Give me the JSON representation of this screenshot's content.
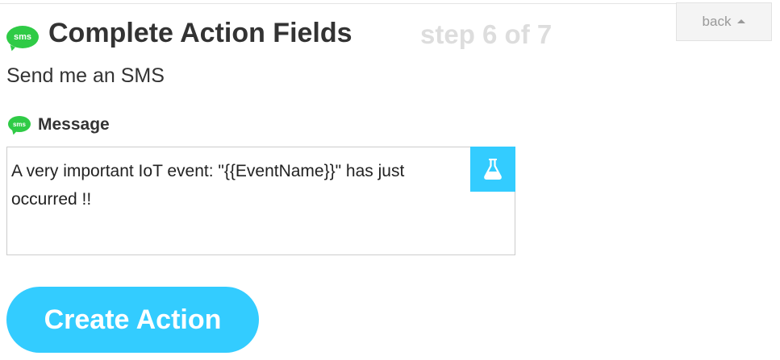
{
  "header": {
    "icon_label": "sms",
    "title": "Complete Action Fields",
    "step": "step 6 of 7",
    "back_label": "back"
  },
  "action": {
    "subtitle": "Send me an SMS"
  },
  "field": {
    "icon_label": "sms",
    "label": "Message",
    "value": "A very important IoT event: \"{{EventName}}\" has just occurred !!"
  },
  "submit": {
    "label": "Create Action"
  },
  "icons": {
    "service": "sms-icon",
    "ingredients": "flask-icon",
    "back": "caret-up-icon"
  },
  "colors": {
    "accent": "#33ccff",
    "sms_green": "#2fcb46",
    "step_text": "#dddddd"
  }
}
